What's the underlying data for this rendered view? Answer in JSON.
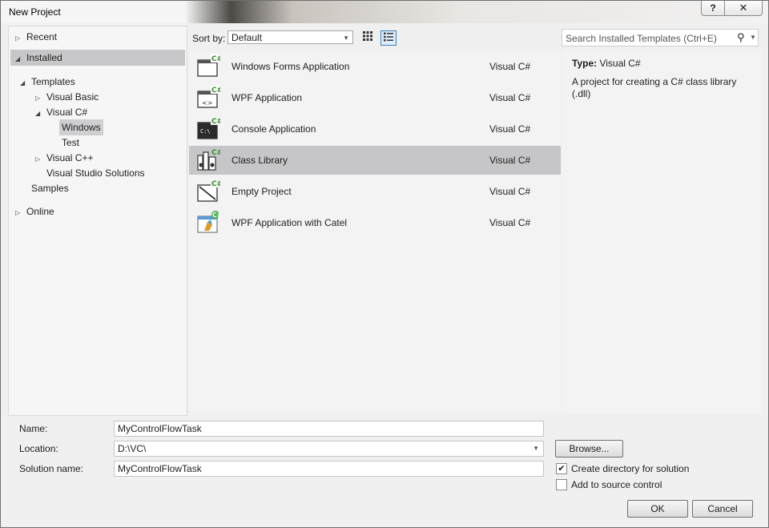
{
  "window": {
    "title": "New Project",
    "help_label": "?",
    "close_label": "✕"
  },
  "tree": {
    "recent": "Recent",
    "installed": "Installed",
    "templates": "Templates",
    "visual_basic": "Visual Basic",
    "visual_csharp": "Visual C#",
    "windows": "Windows",
    "test": "Test",
    "visual_cpp": "Visual C++",
    "vs_solutions": "Visual Studio Solutions",
    "samples": "Samples",
    "online": "Online"
  },
  "toolbar": {
    "sort_label": "Sort by:",
    "sort_value": "Default"
  },
  "templates": [
    {
      "name": "Windows Forms Application",
      "lang": "Visual C#",
      "icon": "windows-forms-icon"
    },
    {
      "name": "WPF Application",
      "lang": "Visual C#",
      "icon": "wpf-application-icon"
    },
    {
      "name": "Console Application",
      "lang": "Visual C#",
      "icon": "console-application-icon"
    },
    {
      "name": "Class Library",
      "lang": "Visual C#",
      "icon": "class-library-icon",
      "selected": true
    },
    {
      "name": "Empty Project",
      "lang": "Visual C#",
      "icon": "empty-project-icon"
    },
    {
      "name": "WPF Application with Catel",
      "lang": "Visual C#",
      "icon": "wpf-catel-icon"
    }
  ],
  "search": {
    "placeholder": "Search Installed Templates (Ctrl+E)"
  },
  "details": {
    "type_label": "Type:",
    "type_value": "Visual C#",
    "description": "A project for creating a C# class library (.dll)"
  },
  "form": {
    "name_label": "Name:",
    "name_value": "MyControlFlowTask",
    "location_label": "Location:",
    "location_value": "D:\\VC\\",
    "solution_label": "Solution name:",
    "solution_value": "MyControlFlowTask",
    "browse_label": "Browse...",
    "create_dir_label": "Create directory for solution",
    "create_dir_checked": true,
    "source_control_label": "Add to source control",
    "source_control_checked": false,
    "ok_label": "OK",
    "cancel_label": "Cancel"
  },
  "colors": {
    "selection": "#c6c6c8",
    "accent": "#3c7fb1",
    "csharp_badge": "#3a8c2f"
  }
}
